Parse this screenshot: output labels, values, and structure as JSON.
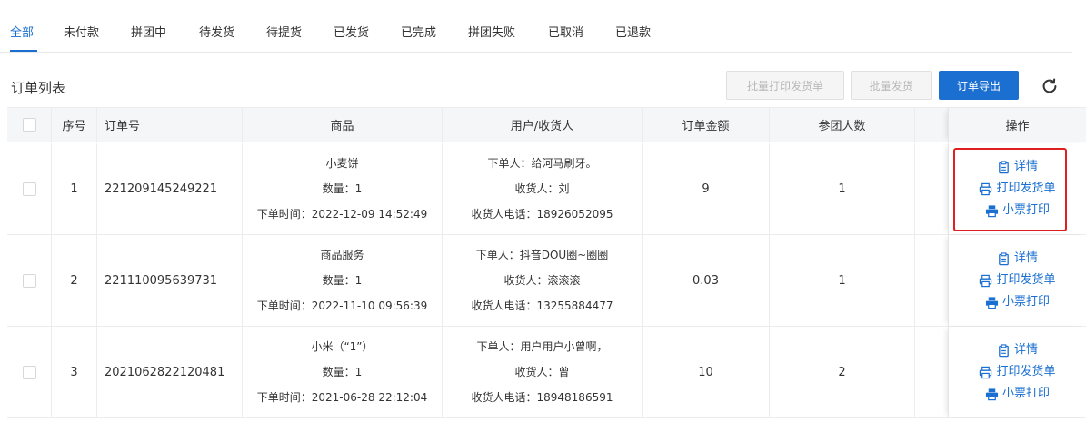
{
  "tabs": [
    "全部",
    "未付款",
    "拼团中",
    "待发货",
    "待提货",
    "已发货",
    "已完成",
    "拼团失败",
    "已取消",
    "已退款"
  ],
  "list_title": "订单列表",
  "buttons": {
    "batch_print": "批量打印发货单",
    "batch_ship": "批量发货",
    "export": "订单导出"
  },
  "columns": {
    "index": "序号",
    "order_no": "订单号",
    "goods": "商品",
    "user": "用户/收货人",
    "amount": "订单金额",
    "participants": "参团人数",
    "actions": "操作"
  },
  "actions": {
    "detail": "详情",
    "print_ship": "打印发货单",
    "print_receipt": "小票打印"
  },
  "rows": [
    {
      "index": "1",
      "order_no": "221209145249221",
      "goods_name": "小麦饼",
      "qty": "数量：1",
      "order_time": "下单时间：2022-12-09 14:52:49",
      "buyer": "下单人：给河马刷牙。",
      "receiver": "收货人：刘",
      "phone": "收货人电话：18926052095",
      "amount": "9",
      "participants": "1"
    },
    {
      "index": "2",
      "order_no": "221110095639731",
      "goods_name": "商品服务",
      "qty": "数量：1",
      "order_time": "下单时间：2022-11-10 09:56:39",
      "buyer": "下单人：抖音DOU圈~圈圈",
      "receiver": "收货人：滚滚滚",
      "phone": "收货人电话：13255884477",
      "amount": "0.03",
      "participants": "1"
    },
    {
      "index": "3",
      "order_no": "2021062822120481",
      "goods_name": "小米（“1”）",
      "qty": "数量：1",
      "order_time": "下单时间：2021-06-28 22:12:04",
      "buyer": "下单人：用户用户小曾啊，",
      "receiver": "收货人：曾",
      "phone": "收货人电话：18948186591",
      "amount": "10",
      "participants": "2"
    }
  ],
  "colors": {
    "primary": "#1a6fd1",
    "highlight": "#e02020"
  }
}
